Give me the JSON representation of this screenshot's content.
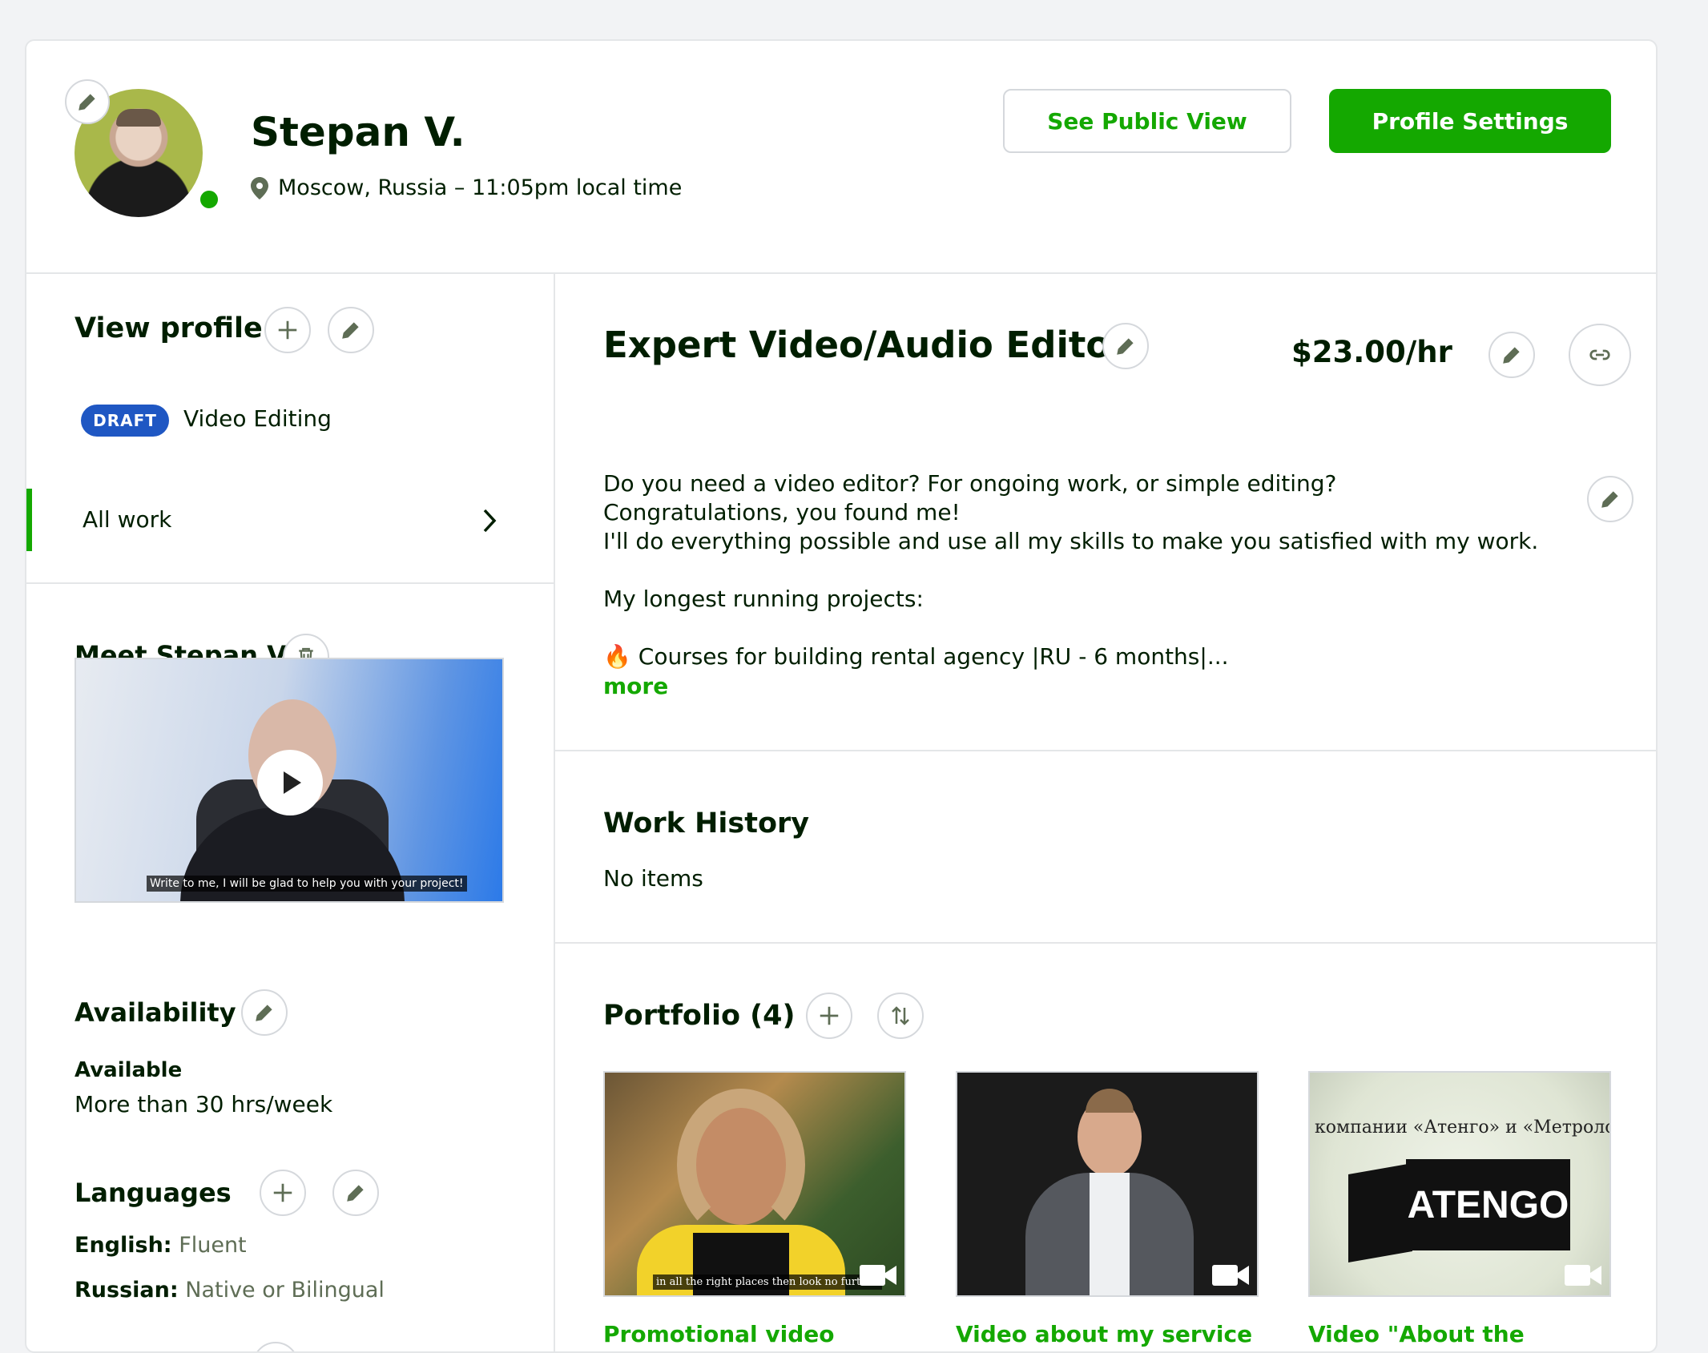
{
  "header": {
    "name": "Stepan V.",
    "location": "Moscow, Russia – 11:05pm local time",
    "see_public_view": "See Public View",
    "profile_settings": "Profile Settings"
  },
  "sidebar": {
    "view_profile_title": "View profile",
    "draft_badge": "DRAFT",
    "draft_profile": "Video Editing",
    "all_work": "All work",
    "meet_title": "Meet Stepan V.",
    "video_subtitle": "Write to me, I will be glad to help you with your project!",
    "availability_title": "Availability",
    "availability_status": "Available",
    "availability_hours": "More than 30 hrs/week",
    "languages_title": "Languages",
    "languages": [
      {
        "name": "English:",
        "level": "Fluent"
      },
      {
        "name": "Russian:",
        "level": "Native or Bilingual"
      }
    ]
  },
  "main": {
    "title": "Expert Video/Audio Editor",
    "rate": "$23.00/hr",
    "description": [
      "Do you need a video editor? For ongoing work, or simple editing?",
      "Congratulations, you found me!",
      "I'll do everything possible and use all my skills to make you satisfied with my work.",
      "",
      "My longest running projects:",
      "",
      "🔥 Courses for building rental agency |RU - 6 months|..."
    ],
    "more": "more",
    "work_history_title": "Work History",
    "work_history_empty": "No items",
    "portfolio_title": "Portfolio (4)",
    "portfolio": [
      {
        "title": "Promotional video",
        "caption": "in all the right places then look no further"
      },
      {
        "title": "Video about my service"
      },
      {
        "title": "Video \"About the company\" for employees.",
        "overlay": "компании «Атенго» и «Метроло",
        "logo": "ATENGO"
      }
    ]
  },
  "colors": {
    "accent": "#14a800",
    "draft": "#1f57c3",
    "text": "#001e00"
  },
  "icons": [
    "pencil-icon",
    "plus-icon",
    "trash-icon",
    "location-pin-icon",
    "chevron-right-icon",
    "link-icon",
    "sort-icon",
    "play-icon",
    "video-camera-icon"
  ]
}
